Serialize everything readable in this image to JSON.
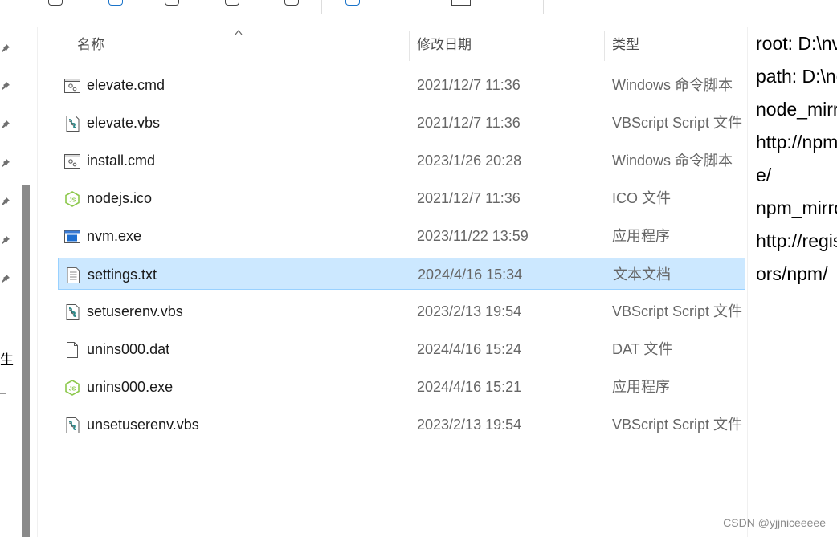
{
  "columns": {
    "name": "名称",
    "date": "修改日期",
    "type": "类型"
  },
  "files": [
    {
      "name": "elevate.cmd",
      "date": "2021/12/7 11:36",
      "type": "Windows 命令脚本",
      "icon": "cmd-script-icon"
    },
    {
      "name": "elevate.vbs",
      "date": "2021/12/7 11:36",
      "type": "VBScript Script 文件",
      "icon": "vbs-script-icon"
    },
    {
      "name": "install.cmd",
      "date": "2023/1/26 20:28",
      "type": "Windows 命令脚本",
      "icon": "cmd-script-icon"
    },
    {
      "name": "nodejs.ico",
      "date": "2021/12/7 11:36",
      "type": "ICO 文件",
      "icon": "nodejs-icon"
    },
    {
      "name": "nvm.exe",
      "date": "2023/11/22 13:59",
      "type": "应用程序",
      "icon": "app-window-icon"
    },
    {
      "name": "settings.txt",
      "date": "2024/4/16 15:34",
      "type": "文本文档",
      "icon": "text-document-icon",
      "selected": true
    },
    {
      "name": "setuserenv.vbs",
      "date": "2023/2/13 19:54",
      "type": "VBScript Script 文件",
      "icon": "vbs-script-icon"
    },
    {
      "name": "unins000.dat",
      "date": "2024/4/16 15:24",
      "type": "DAT 文件",
      "icon": "blank-file-icon"
    },
    {
      "name": "unins000.exe",
      "date": "2024/4/16 15:21",
      "type": "应用程序",
      "icon": "nodejs-icon"
    },
    {
      "name": "unsetuserenv.vbs",
      "date": "2023/2/13 19:54",
      "type": "VBScript Script 文件",
      "icon": "vbs-script-icon"
    }
  ],
  "leftnav": {
    "partial_label": "生"
  },
  "preview": {
    "lines": [
      "root: D:\\nvm",
      "path: D:\\nodejs",
      "node_mirror:",
      "http://npm",
      "e/",
      "npm_mirror:",
      "http://registry",
      "ors/npm/"
    ]
  },
  "watermark": "CSDN @yjjniceeeee",
  "colors": {
    "selected_bg": "#cce8ff",
    "selected_border": "#99d1ff",
    "secondary_text": "#666666",
    "nodejs_green": "#8cc84b"
  }
}
